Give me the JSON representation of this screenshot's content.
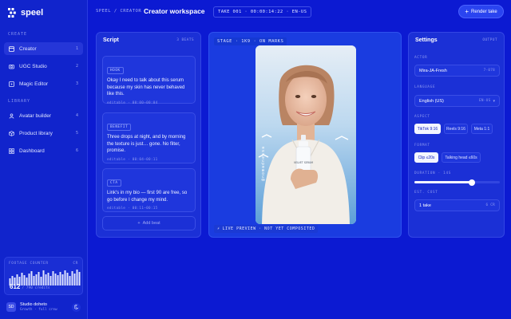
{
  "brand": {
    "name": "speel"
  },
  "sidebar": {
    "create_label": "CREATE",
    "library_label": "LIBRARY",
    "create_items": [
      {
        "label": "Creator",
        "badge": "1",
        "icon": "square-icon",
        "active": true
      },
      {
        "label": "UGC Studio",
        "badge": "2",
        "icon": "camera-icon",
        "active": false
      },
      {
        "label": "Magic Editor",
        "badge": "3",
        "icon": "film-icon",
        "active": false
      }
    ],
    "library_items": [
      {
        "label": "Avatar builder",
        "badge": "4",
        "icon": "person-icon"
      },
      {
        "label": "Product library",
        "badge": "5",
        "icon": "box-icon"
      },
      {
        "label": "Dashboard",
        "badge": "6",
        "icon": "grid-icon"
      }
    ],
    "footage": {
      "label": "FOOTAGE COUNTER",
      "tag": "CR",
      "used": "612",
      "total_text": "/ 790 credits",
      "bar_levels": [
        0.45,
        0.6,
        0.5,
        0.7,
        0.55,
        0.8,
        0.65,
        0.5,
        0.75,
        0.9,
        0.6,
        0.7,
        0.85,
        0.55,
        0.95,
        0.7,
        0.8,
        0.6,
        0.9,
        0.75,
        0.65,
        0.85,
        0.7,
        0.95,
        0.8,
        0.6,
        0.9,
        0.75,
        1.0,
        0.85
      ]
    },
    "user": {
      "initials": "SD",
      "name": "Studio doheto",
      "plan": "Growth · full crew"
    }
  },
  "header": {
    "breadcrumb": "SPEEL / CREATOR",
    "title": "Creator workspace",
    "take_info": "TAKE 001 · 00:00:14:22 · EN-US",
    "render_label": "Render take"
  },
  "script": {
    "title": "Script",
    "count": "3 BEATS",
    "beats": [
      {
        "tag": "HOOK",
        "text": "Okay I need to talk about this serum because my skin has never behaved like this.",
        "meta": "editable · 00:00–00:04"
      },
      {
        "tag": "BENEFIT",
        "text": "Three drops at night, and by morning the texture is just… gone. No filter, promise.",
        "meta": "editable · 00:04–00:11"
      },
      {
        "tag": "CTA",
        "text": "Link's in my bio — first 90 are free, so go before I change my mind.",
        "meta": "editable · 00:11–00:15"
      }
    ],
    "add_label": "Add beat"
  },
  "stage": {
    "label": "STAGE · 1K9 · ON MARKS",
    "live_label": "LIVE PREVIEW · NOT YET COMPOSITED",
    "bottle_text": "VELVET SERUM",
    "vertical_text": "@nomadnessa"
  },
  "settings": {
    "title": "Settings",
    "subtitle": "OUTPUT",
    "actor_label": "ACTOR",
    "actor_value": "Mira-JA-Fresh",
    "actor_meta": "7·078",
    "language_label": "LANGUAGE",
    "language_value": "English (US)",
    "language_code": "EN-US",
    "aspect_label": "ASPECT",
    "aspects": [
      {
        "label": "TikTok 9:16",
        "selected": true
      },
      {
        "label": "Reels 9:16",
        "selected": false
      },
      {
        "label": "Meta 1:1",
        "selected": false
      }
    ],
    "format_label": "FORMAT",
    "formats": [
      {
        "label": "Clip ≤20s",
        "selected": true
      },
      {
        "label": "Talking head ≤60s",
        "selected": false
      }
    ],
    "duration_label": "DURATION · 14S",
    "duration_fraction": 0.67,
    "cost_label": "EST. COST",
    "cost_value": "1 take",
    "cost_unit": "6 CR"
  },
  "colors": {
    "background": "#0c1ad2",
    "panel": "#1b30d6",
    "accent": "#2a44f0",
    "chip_selected": "#f3f5ff"
  }
}
